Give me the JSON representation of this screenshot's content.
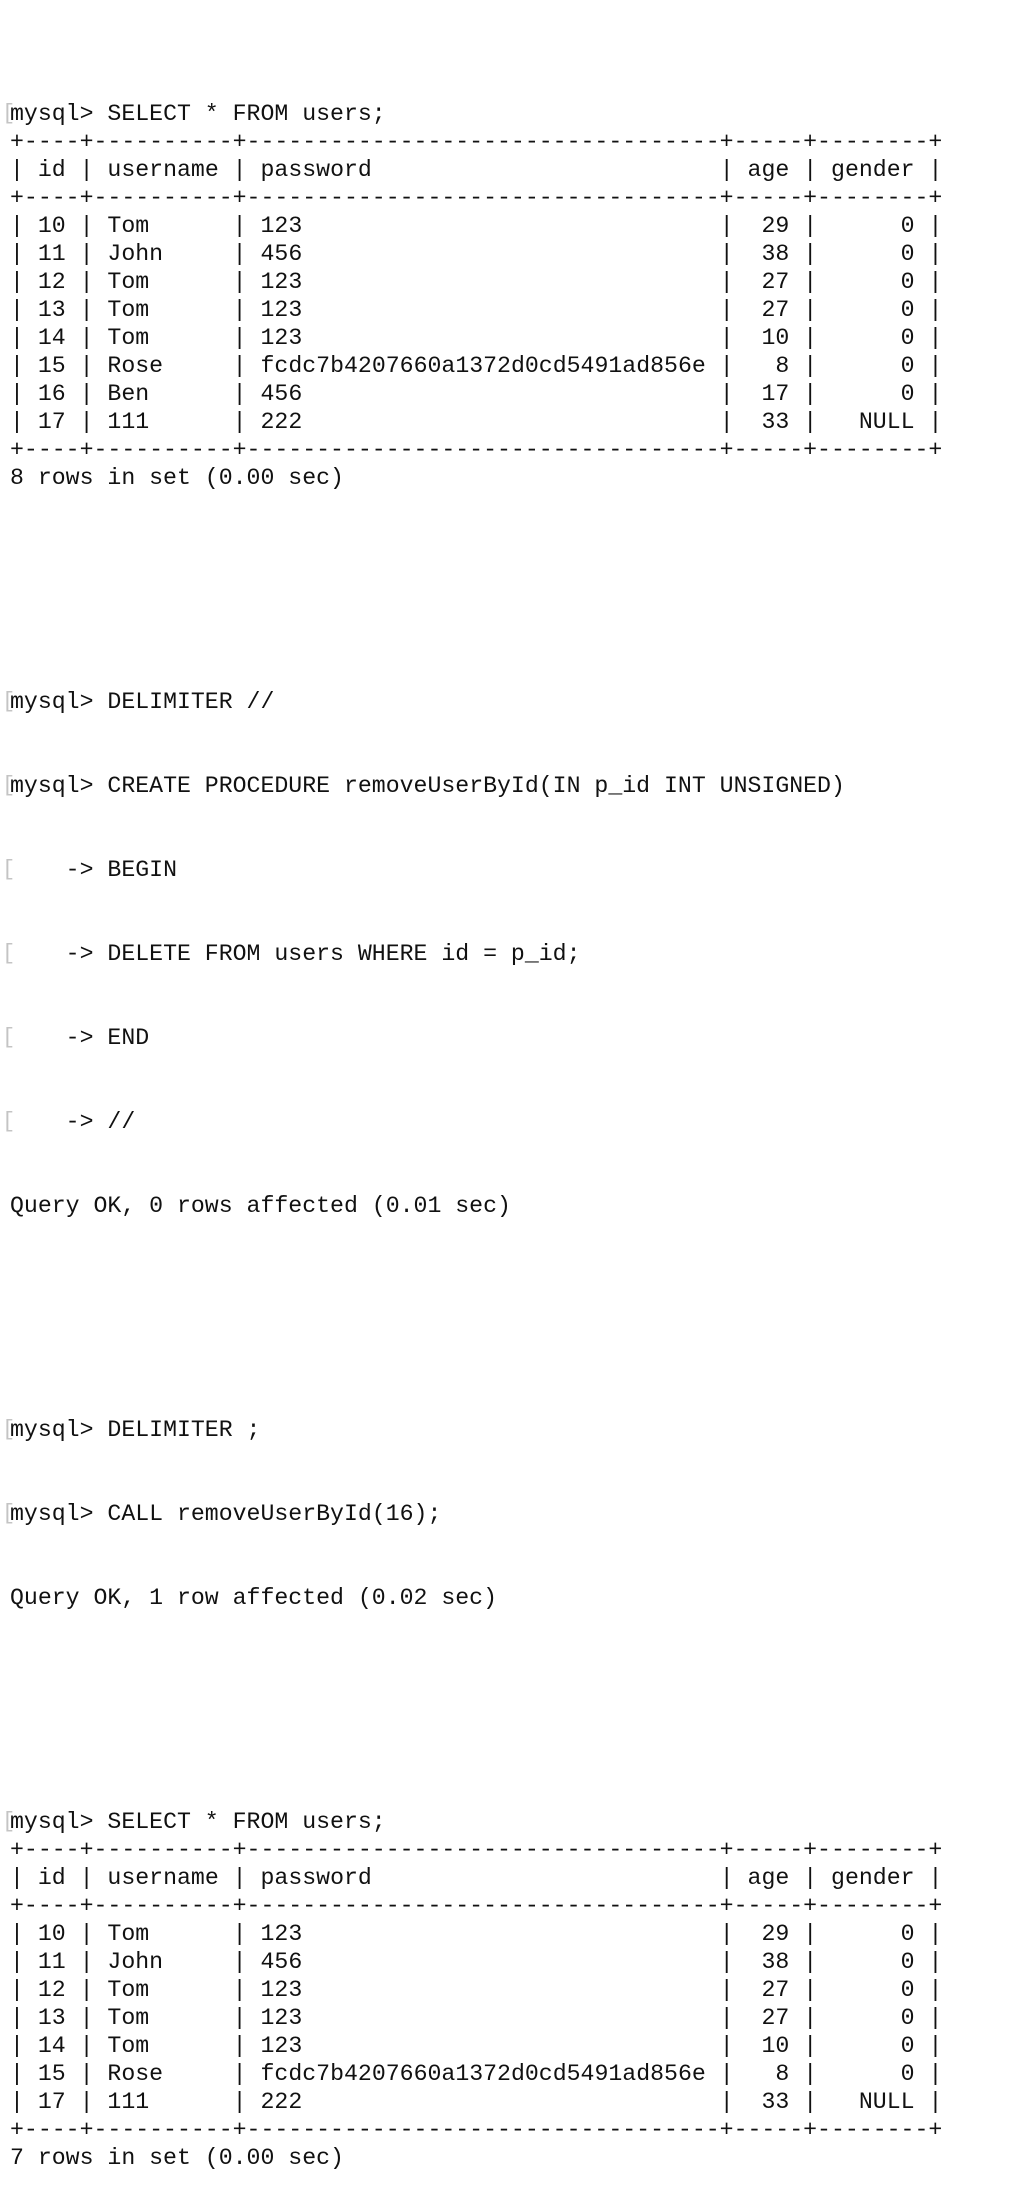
{
  "terminal": {
    "prompt": "mysql> ",
    "continuation_prompt": "    -> ",
    "query_tables": [
      {
        "command": "SELECT * FROM users;",
        "columns": [
          {
            "name": "id",
            "width": 2,
            "align": "right"
          },
          {
            "name": "username",
            "width": 8,
            "align": "left"
          },
          {
            "name": "password",
            "width": 32,
            "align": "left"
          },
          {
            "name": "age",
            "width": 3,
            "align": "right"
          },
          {
            "name": "gender",
            "width": 6,
            "align": "right"
          }
        ],
        "rows": [
          [
            "10",
            "Tom",
            "123",
            "29",
            "0"
          ],
          [
            "11",
            "John",
            "456",
            "38",
            "0"
          ],
          [
            "12",
            "Tom",
            "123",
            "27",
            "0"
          ],
          [
            "13",
            "Tom",
            "123",
            "27",
            "0"
          ],
          [
            "14",
            "Tom",
            "123",
            "10",
            "0"
          ],
          [
            "15",
            "Rose",
            "fcdc7b4207660a1372d0cd5491ad856e",
            "8",
            "0"
          ],
          [
            "16",
            "Ben",
            "456",
            "17",
            "0"
          ],
          [
            "17",
            "111",
            "222",
            "33",
            "NULL"
          ]
        ],
        "result": "8 rows in set (0.00 sec)"
      },
      {
        "command": "SELECT * FROM users;",
        "columns": [
          {
            "name": "id",
            "width": 2,
            "align": "right"
          },
          {
            "name": "username",
            "width": 8,
            "align": "left"
          },
          {
            "name": "password",
            "width": 32,
            "align": "left"
          },
          {
            "name": "age",
            "width": 3,
            "align": "right"
          },
          {
            "name": "gender",
            "width": 6,
            "align": "right"
          }
        ],
        "rows": [
          [
            "10",
            "Tom",
            "123",
            "29",
            "0"
          ],
          [
            "11",
            "John",
            "456",
            "38",
            "0"
          ],
          [
            "12",
            "Tom",
            "123",
            "27",
            "0"
          ],
          [
            "13",
            "Tom",
            "123",
            "27",
            "0"
          ],
          [
            "14",
            "Tom",
            "123",
            "10",
            "0"
          ],
          [
            "15",
            "Rose",
            "fcdc7b4207660a1372d0cd5491ad856e",
            "8",
            "0"
          ],
          [
            "17",
            "111",
            "222",
            "33",
            "NULL"
          ]
        ],
        "result": "7 rows in set (0.00 sec)"
      }
    ],
    "procedure_block": {
      "delimiter_cmd": "DELIMITER //",
      "create_cmd": "CREATE PROCEDURE removeUserById(IN p_id INT UNSIGNED)",
      "body_lines": [
        "BEGIN",
        "DELETE FROM users WHERE id = p_id;",
        "END",
        "//"
      ],
      "result": "Query OK, 0 rows affected (0.01 sec)"
    },
    "call_block": {
      "delimiter_cmd": "DELIMITER ;",
      "call_cmd": "CALL removeUserById(16);",
      "result": "Query OK, 1 row affected (0.02 sec)"
    }
  }
}
